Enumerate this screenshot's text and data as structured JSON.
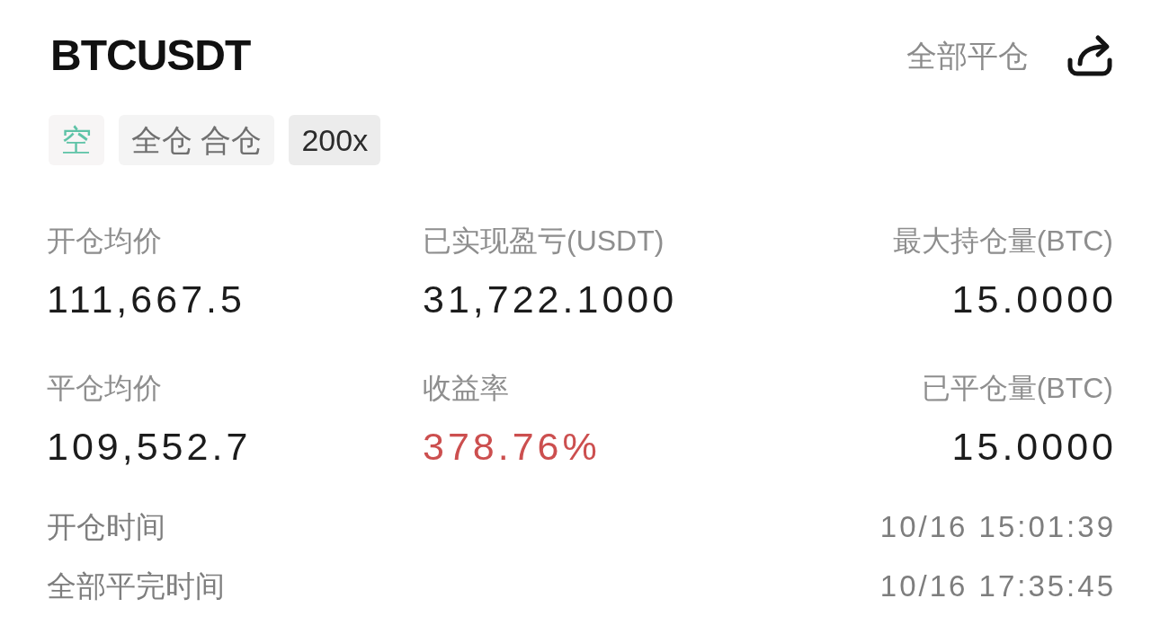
{
  "header": {
    "symbol": "BTCUSDT",
    "close_all": "全部平仓"
  },
  "tags": [
    {
      "kind": "side",
      "label": "空"
    },
    {
      "kind": "mode",
      "label": "全仓 合仓"
    },
    {
      "kind": "leverage",
      "label": "200x"
    }
  ],
  "stats": [
    {
      "kind": "plain",
      "label": "开仓均价",
      "value": "111,667.5"
    },
    {
      "kind": "plain",
      "label": "已实现盈亏(USDT)",
      "value": "31,722.1000"
    },
    {
      "kind": "plain",
      "label": "最大持仓量(BTC)",
      "value": "15.0000"
    },
    {
      "kind": "plain",
      "label": "平仓均价",
      "value": "109,552.7"
    },
    {
      "kind": "profit",
      "label": "收益率",
      "value": "378.76%"
    },
    {
      "kind": "plain",
      "label": "已平仓量(BTC)",
      "value": "15.0000"
    }
  ],
  "times": [
    {
      "label": "开仓时间",
      "value": "10/16 15:01:39"
    },
    {
      "label": "全部平完时间",
      "value": "10/16 17:35:45"
    }
  ]
}
